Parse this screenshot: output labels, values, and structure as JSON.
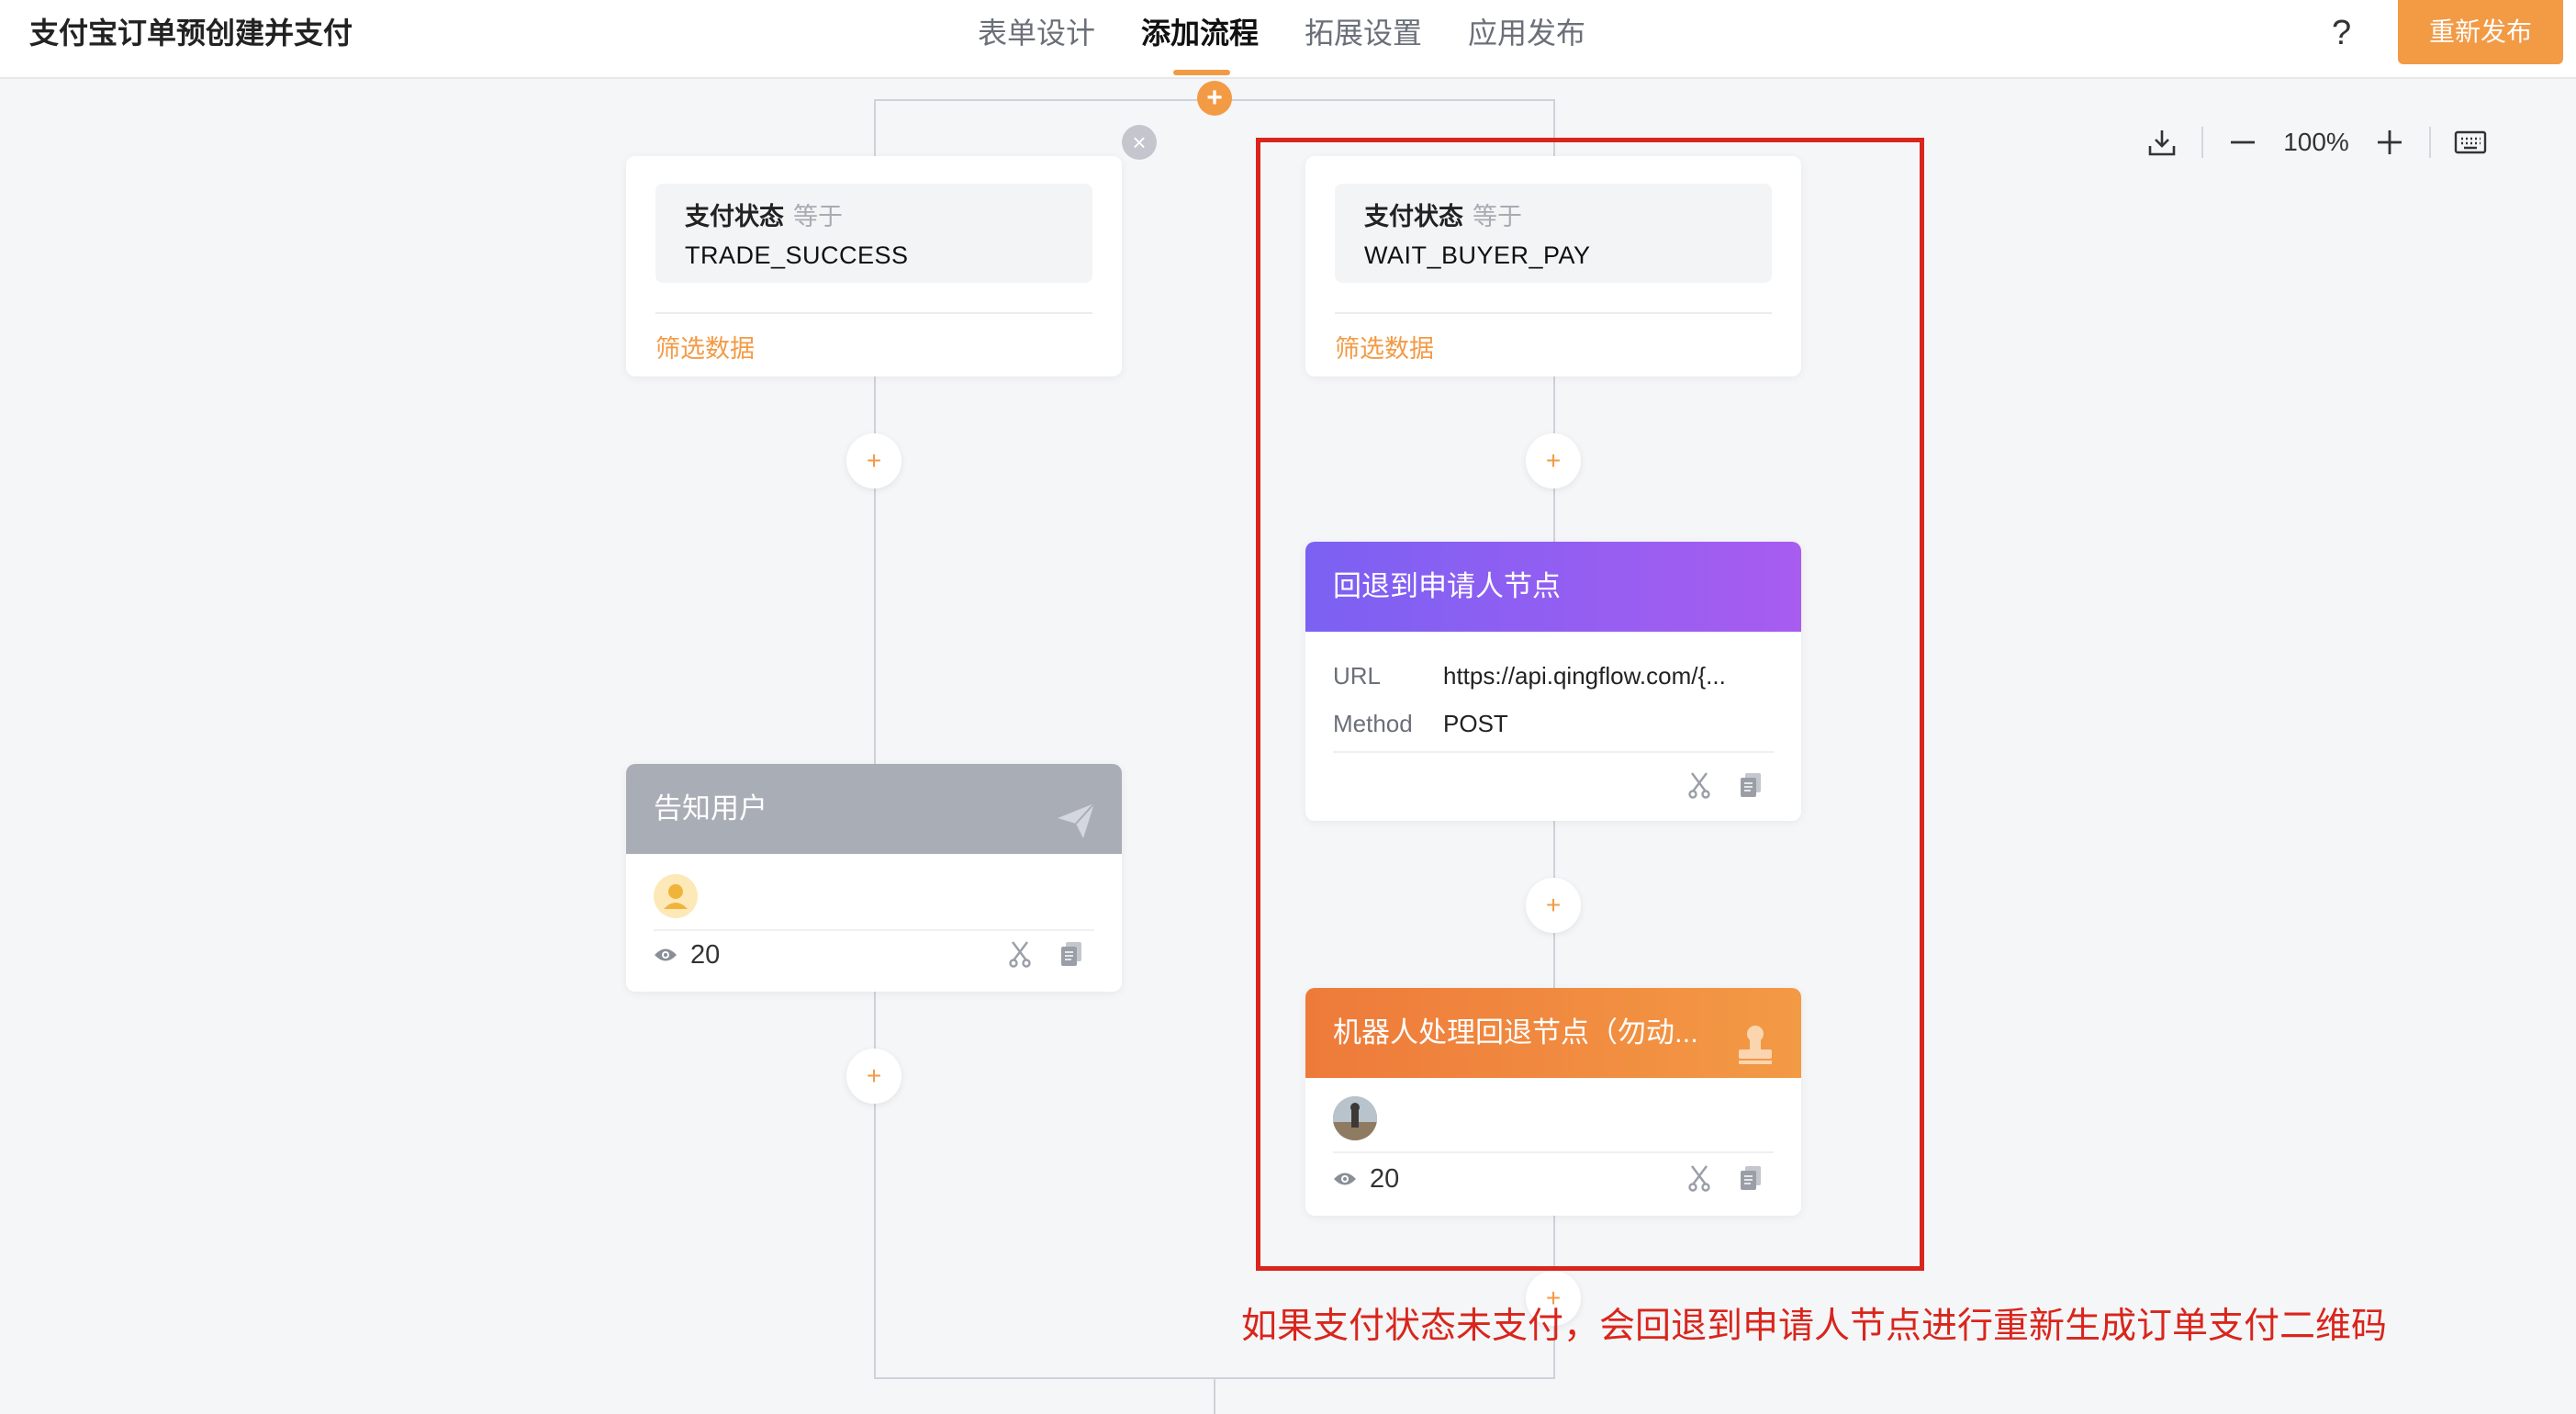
{
  "header": {
    "title": "支付宝订单预创建并支付",
    "tabs": [
      {
        "label": "表单设计",
        "active": false
      },
      {
        "label": "添加流程",
        "active": true
      },
      {
        "label": "拓展设置",
        "active": false
      },
      {
        "label": "应用发布",
        "active": false
      }
    ],
    "help_label": "?",
    "publish_label": "重新发布",
    "accent_color": "#f39a45"
  },
  "toolbar": {
    "zoom": "100%",
    "icons": [
      "download-icon",
      "zoom-out-icon",
      "zoom-in-icon",
      "keyboard-icon"
    ]
  },
  "branch_left": {
    "condition": {
      "field": "支付状态",
      "operator": "等于",
      "value": "TRADE_SUCCESS",
      "filter_label": "筛选数据"
    },
    "notify_node": {
      "title": "告知用户",
      "count": "20",
      "icon": "send-icon"
    }
  },
  "branch_right": {
    "condition": {
      "field": "支付状态",
      "operator": "等于",
      "value": "WAIT_BUYER_PAY",
      "filter_label": "筛选数据"
    },
    "webhook_node": {
      "title": "回退到申请人节点",
      "url_key": "URL",
      "url_value": "https://api.qingflow.com/{...",
      "method_key": "Method",
      "method_value": "POST"
    },
    "robot_node": {
      "title": "机器人处理回退节点（勿动...",
      "count": "20",
      "icon": "stamp-icon"
    }
  },
  "annotation": {
    "text": "如果支付状态未支付，会回退到申请人节点进行重新生成订单支付二维码",
    "color": "#d9251c"
  },
  "plus_label": "+",
  "close_label": "×"
}
